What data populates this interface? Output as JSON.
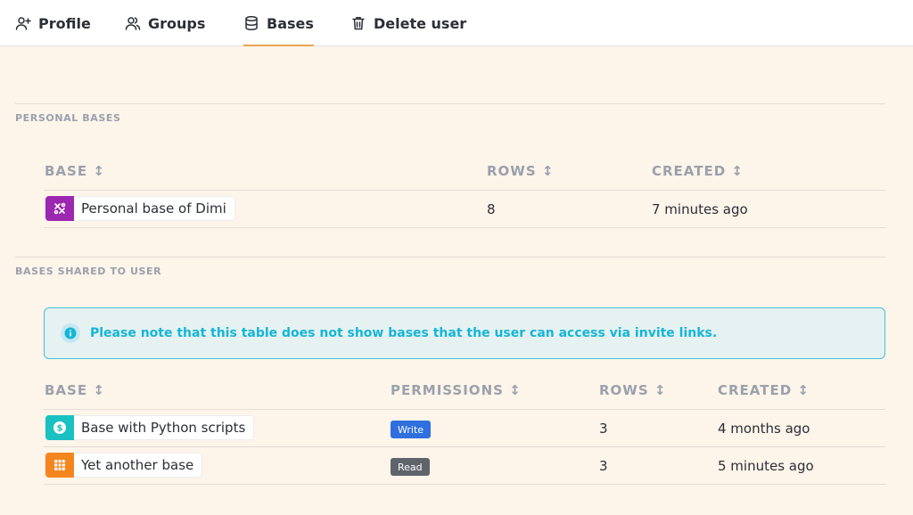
{
  "tabs": [
    {
      "label": "Profile",
      "icon": "user-plus-icon"
    },
    {
      "label": "Groups",
      "icon": "users-icon"
    },
    {
      "label": "Bases",
      "icon": "database-icon",
      "active": true
    },
    {
      "label": "Delete user",
      "icon": "trash-icon"
    }
  ],
  "personal": {
    "title": "PERSONAL BASES",
    "headers": {
      "base": "BASE ↕",
      "rows": "ROWS ↕",
      "created": "CREATED ↕"
    },
    "rows": [
      {
        "name": "Personal base of Dimi",
        "icon": "tools-icon",
        "color": "#9c27b0",
        "rows": "8",
        "created": "7 minutes ago"
      }
    ]
  },
  "shared": {
    "title": "BASES SHARED TO USER",
    "notice": "Please note that this table does not show bases that the user can access via invite links.",
    "headers": {
      "base": "BASE ↕",
      "permissions": "PERMISSIONS ↕",
      "rows": "ROWS ↕",
      "created": "CREATED ↕"
    },
    "rows": [
      {
        "name": "Base with Python scripts",
        "icon": "dollar-icon",
        "color": "#1ac1c1",
        "permission": "Write",
        "permission_color": "#2f6fde",
        "rows": "3",
        "created": "4 months ago"
      },
      {
        "name": "Yet another base",
        "icon": "grid-icon",
        "color": "#f5861f",
        "permission": "Read",
        "permission_color": "#5f646b",
        "rows": "3",
        "created": "5 minutes ago"
      }
    ]
  },
  "colors": {
    "accent": "#e8a44f",
    "info": "#14b5d8",
    "background": "#fdf4ea"
  }
}
